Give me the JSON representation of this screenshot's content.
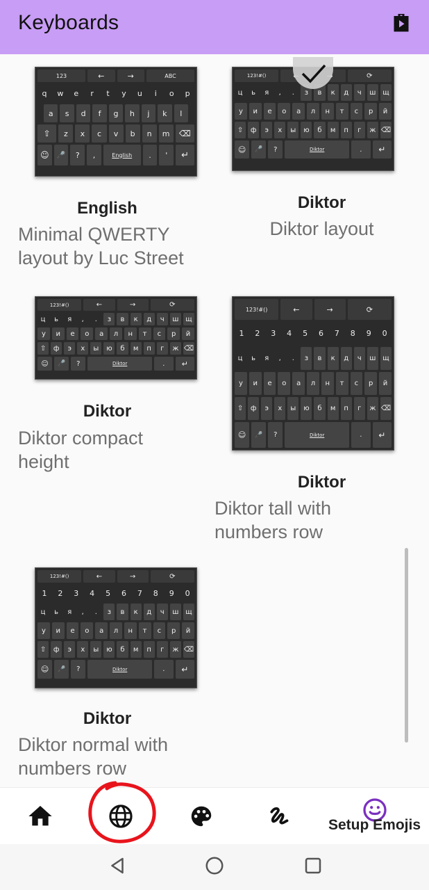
{
  "appbar": {
    "title": "Keyboards",
    "store_icon": "store-bag-icon",
    "color": "#c89df5"
  },
  "keyboards": [
    {
      "name": "English",
      "description_line1": "Minimal QWERTY",
      "description_line2": "layout by Luc Street",
      "top_row": [
        "123",
        "←",
        "→",
        "ABC"
      ],
      "rows": [
        [
          "q",
          "w",
          "e",
          "r",
          "t",
          "y",
          "u",
          "i",
          "o",
          "p"
        ],
        [
          "a",
          "s",
          "d",
          "f",
          "g",
          "h",
          "j",
          "k",
          "l"
        ],
        [
          "⇧",
          "z",
          "x",
          "c",
          "v",
          "b",
          "n",
          "m",
          "⌫"
        ],
        [
          "☺",
          "🎤",
          "?",
          ",",
          "English",
          ".",
          "'",
          "↵"
        ]
      ]
    },
    {
      "name": "Diktor",
      "description_line1": "Diktor layout",
      "description_line2": "",
      "selected": true,
      "top_row": [
        "123!#()",
        "←",
        "→",
        "⟳"
      ],
      "rows": [
        [
          "ц",
          "ь",
          "я",
          ",",
          ".",
          "з",
          "в",
          "к",
          "д",
          "ч",
          "ш",
          "щ"
        ],
        [
          "у",
          "и",
          "е",
          "о",
          "а",
          "л",
          "н",
          "т",
          "с",
          "р",
          "й"
        ],
        [
          "⇧",
          "ф",
          "э",
          "х",
          "ы",
          "ю",
          "б",
          "м",
          "п",
          "г",
          "ж",
          "⌫"
        ],
        [
          "☺",
          "🎤",
          "?",
          "Diktor",
          ".",
          "↵"
        ]
      ]
    },
    {
      "name": "Diktor",
      "description_line1": "Diktor compact",
      "description_line2": "height",
      "top_row": [
        "123!#()",
        "←",
        "→",
        "⟳"
      ],
      "rows": [
        [
          "ц",
          "ь",
          "я",
          ",",
          ".",
          "з",
          "в",
          "к",
          "д",
          "ч",
          "ш",
          "щ"
        ],
        [
          "у",
          "и",
          "е",
          "о",
          "а",
          "л",
          "н",
          "т",
          "с",
          "р",
          "й"
        ],
        [
          "⇧",
          "ф",
          "э",
          "х",
          "ы",
          "ю",
          "б",
          "м",
          "п",
          "г",
          "ж",
          "⌫"
        ],
        [
          "☺",
          "🎤",
          "?",
          "Diktor",
          ".",
          "↵"
        ]
      ]
    },
    {
      "name": "Diktor",
      "description_line1": "Diktor tall with",
      "description_line2": "numbers row",
      "top_row": [
        "123!#()",
        "←",
        "→",
        "⟳"
      ],
      "rows": [
        [
          "1",
          "2",
          "3",
          "4",
          "5",
          "6",
          "7",
          "8",
          "9",
          "0"
        ],
        [
          "ц",
          "ь",
          "я",
          ",",
          ".",
          "з",
          "в",
          "к",
          "д",
          "ч",
          "ш",
          "щ"
        ],
        [
          "у",
          "и",
          "е",
          "о",
          "а",
          "л",
          "н",
          "т",
          "с",
          "р",
          "й"
        ],
        [
          "⇧",
          "ф",
          "э",
          "х",
          "ы",
          "ю",
          "б",
          "м",
          "п",
          "г",
          "ж",
          "⌫"
        ],
        [
          "☺",
          "🎤",
          "?",
          "Diktor",
          ".",
          "↵"
        ]
      ]
    },
    {
      "name": "Diktor",
      "description_line1": "Diktor normal with",
      "description_line2": "numbers row",
      "top_row": [
        "123!#()",
        "←",
        "→",
        "⟳"
      ],
      "rows": [
        [
          "1",
          "2",
          "3",
          "4",
          "5",
          "6",
          "7",
          "8",
          "9",
          "0"
        ],
        [
          "ц",
          "ь",
          "я",
          ",",
          ".",
          "з",
          "в",
          "к",
          "д",
          "ч",
          "ш",
          "щ"
        ],
        [
          "у",
          "и",
          "е",
          "о",
          "а",
          "л",
          "н",
          "т",
          "с",
          "р",
          "й"
        ],
        [
          "⇧",
          "ф",
          "э",
          "х",
          "ы",
          "ю",
          "б",
          "м",
          "п",
          "г",
          "ж",
          "⌫"
        ],
        [
          "☺",
          "🎤",
          "?",
          "Diktor",
          ".",
          "↵"
        ]
      ]
    }
  ],
  "bottom_nav": {
    "items": [
      {
        "icon": "home-icon"
      },
      {
        "icon": "globe-icon",
        "annotated": true
      },
      {
        "icon": "palette-icon"
      },
      {
        "icon": "gesture-icon"
      },
      {
        "icon": "emoji-icon",
        "label": "Setup Emojis"
      }
    ],
    "accent": "#7b2fbf",
    "annotation_color": "#e8141c"
  },
  "system_nav": {
    "icons": [
      "back-icon",
      "home-circle-icon",
      "recents-icon"
    ]
  }
}
